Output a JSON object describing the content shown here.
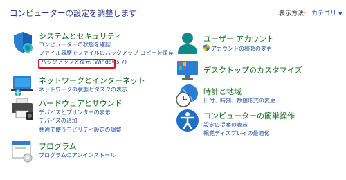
{
  "header": {
    "title": "コンピューターの設定を調整します",
    "view_by_label": "表示方法:",
    "view_by_value": "カテゴリ",
    "view_by_caret": "▼"
  },
  "left_categories": [
    {
      "name": "システムとセキュリティ",
      "icon": "shield-icon",
      "links": [
        "コンピューターの状態を確認",
        "ファイル履歴でファイルのバックアップ コピーを保存",
        "バックアップと復元 (Windows 7)"
      ]
    },
    {
      "name": "ネットワークとインターネット",
      "icon": "network-icon",
      "links": [
        "ネットワークの状態とタスクの表示"
      ]
    },
    {
      "name": "ハードウェアとサウンド",
      "icon": "printer-icon",
      "links": [
        "デバイスとプリンターの表示",
        "デバイスの追加",
        "共通で使うモビリティ設定の調整"
      ]
    },
    {
      "name": "プログラム",
      "icon": "programs-icon",
      "links": [
        "プログラムのアンインストール"
      ]
    }
  ],
  "right_categories": [
    {
      "name": "ユーザー アカウント",
      "icon": "user-icon",
      "links": [
        "アカウントの種類の変更"
      ],
      "link_icon": "uac-shield-icon"
    },
    {
      "name": "デスクトップのカスタマイズ",
      "icon": "desktop-icon",
      "links": []
    },
    {
      "name": "時計と地域",
      "icon": "clock-globe-icon",
      "links": [
        "日付、時刻、数値形式の変更"
      ]
    },
    {
      "name": "コンピューターの簡単操作",
      "icon": "accessibility-icon",
      "links": [
        "設定の提案の表示",
        "視覚ディスプレイの最適化"
      ]
    }
  ],
  "colors": {
    "title": "#1e3287",
    "category_heading": "#0b6a18",
    "link": "#1e50a0",
    "highlight_border": "#e0101a"
  }
}
